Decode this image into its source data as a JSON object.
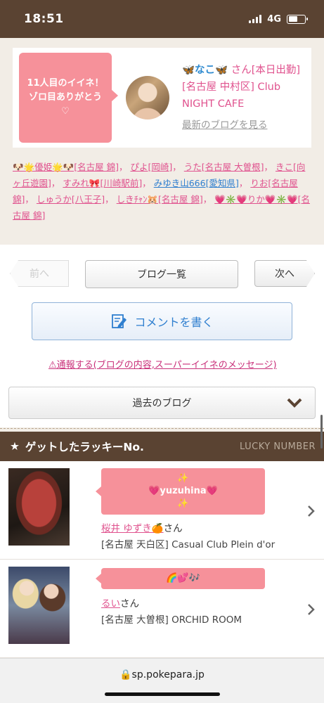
{
  "status": {
    "time": "18:51",
    "network": "4G"
  },
  "card": {
    "bubble_text": "11人目のイイネ！\nゾロ目ありがとう♡",
    "name": "🦋なこ🦋",
    "suffix": " さん[本日出勤]",
    "shop": "[名古屋 中村区] Club NIGHT CAFE",
    "blog_link": "最新のブログを見る"
  },
  "names": [
    {
      "text": "🐶🌟優姫🌟🐶[名古屋 錦]",
      "color": "pink"
    },
    {
      "text": "ぴよ[岡崎]",
      "color": "pink"
    },
    {
      "text": "うた[名古屋 大曽根]",
      "color": "pink"
    },
    {
      "text": "きこ[向ヶ丘遊園]",
      "color": "pink"
    },
    {
      "text": "すみれ🎀[川崎駅前]",
      "color": "pink"
    },
    {
      "text": "みゆき山666[愛知県]",
      "color": "blue"
    },
    {
      "text": "りお[名古屋 錦]",
      "color": "pink"
    },
    {
      "text": "しゅうか[八王子]",
      "color": "pink"
    },
    {
      "text": "しきﾁｬﾝ🐹[名古屋 錦]",
      "color": "pink"
    },
    {
      "text": "💗✳️💗りか💗✳️💗[名古屋 錦]",
      "color": "pink"
    }
  ],
  "nav": {
    "prev": "前へ",
    "list": "ブログ一覧",
    "next": "次へ",
    "comment": "コメントを書く",
    "report": "⚠通報する(ブログの内容,スーパーイイネのメッセージ)",
    "past_blog": "過去のブログ"
  },
  "lucky": {
    "title": "ゲットしたラッキーNo.",
    "title_en": "LUCKY NUMBER",
    "items": [
      {
        "tag": "✨\n💗yuzuhina💗\n✨",
        "name": "桜井 ゆずき🍊",
        "name_suffix": "さん",
        "shop": "[名古屋 天白区] Casual Club Plein d'or"
      },
      {
        "tag": "🌈💕🎶",
        "name": "るい",
        "name_suffix": "さん",
        "shop": "[名古屋 大曽根] ORCHID ROOM"
      }
    ]
  },
  "url": "sp.pokepara.jp",
  "colors": {
    "brown": "#5a4332",
    "pink": "#f6919a",
    "link_pink": "#e0528e",
    "link_blue": "#2f7fcf"
  }
}
